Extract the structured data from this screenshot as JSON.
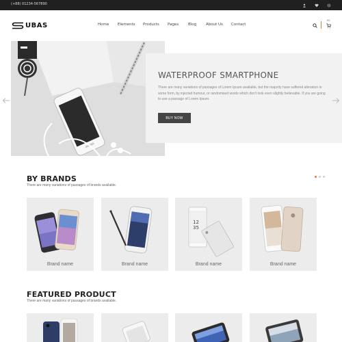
{
  "topbar": {
    "phone": "(+88) 01234-567890",
    "icons": [
      "user-icon",
      "heart-icon",
      "settings-icon"
    ]
  },
  "brand": {
    "logo_text": "UBAS"
  },
  "nav": [
    "Home",
    "Elements",
    "Products",
    "Pages",
    "Blog",
    "About Us",
    "Contact"
  ],
  "header_icons": [
    "search-icon",
    "cart-icon"
  ],
  "cart": {
    "count": "02"
  },
  "hero": {
    "title": "WATERPROOF SMARTPHONE",
    "text": "There are many variations of passages of Lorem Ipsum available, but the majority have suffered alteration in some form, by injected humour, or randomised words which don't look even slightly believable. If you are going to use a passage of Lorem Ipsum.",
    "button": "BUY NOW",
    "slides_count": 3,
    "active_slide": 1
  },
  "brands": {
    "title": "BY BRANDS",
    "subtitle": "There are many variations of passages of brands available.",
    "items": [
      "Brand name",
      "Brand name",
      "Brand name",
      "Brand name"
    ]
  },
  "featured": {
    "title": "FEATURED PRODUCT",
    "subtitle": "There are many variations of passages of brands available."
  },
  "colors": {
    "accent": "#e07a3f",
    "dark": "#202020",
    "button": "#444444",
    "card_bg": "#ececec"
  }
}
